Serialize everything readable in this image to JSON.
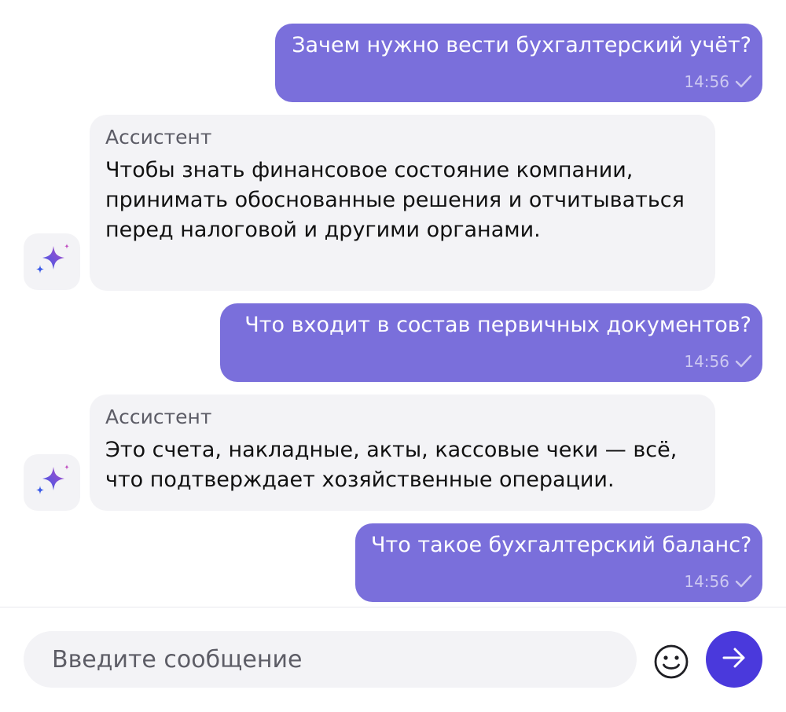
{
  "messages": [
    {
      "type": "out",
      "text": "Зачем нужно вести бухгалтерский учёт?",
      "time": "14:56"
    },
    {
      "type": "in",
      "sender": "Ассистент",
      "text": "Чтобы знать финансовое состояние компании, принимать обоснованные решения и отчитываться перед налоговой и другими органами."
    },
    {
      "type": "out",
      "text": "Что входит в состав первичных документов?",
      "time": "14:56"
    },
    {
      "type": "in",
      "sender": "Ассистент",
      "text": "Это счета, накладные, акты, кассовые чеки — всё, что подтверждает хозяйственные операции."
    },
    {
      "type": "out",
      "text": "Что такое бухгалтерский баланс?",
      "time": "14:56"
    }
  ],
  "composer": {
    "placeholder": "Введите сообщение",
    "value": ""
  },
  "icons": {
    "assistant_avatar": "sparkle-icon",
    "read_status": "check-icon",
    "emoji": "smiley-icon",
    "send": "arrow-right-icon"
  },
  "colors": {
    "outgoing_bubble": "#7a6fdb",
    "incoming_bubble": "#f3f3f6",
    "send_button": "#4a39dc"
  }
}
